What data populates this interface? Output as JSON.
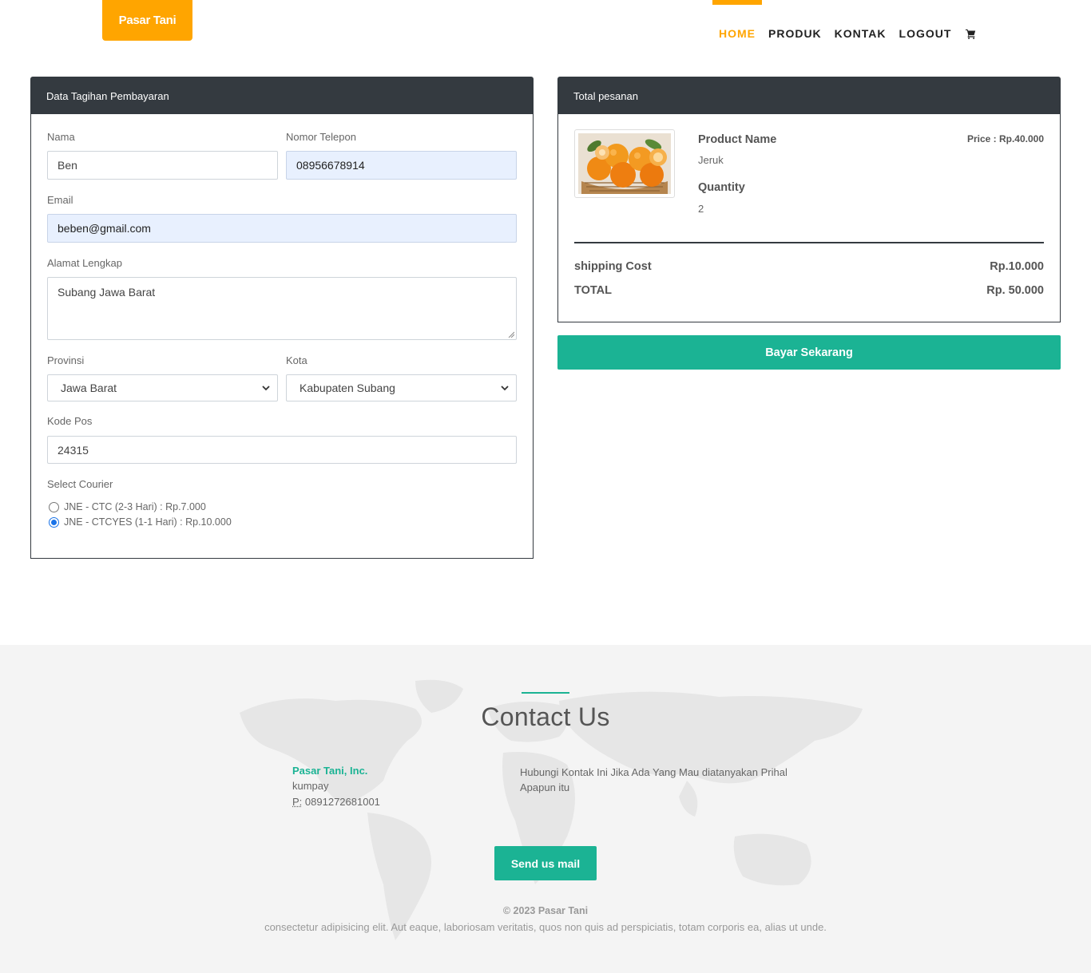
{
  "brand": "Pasar Tani",
  "nav": [
    {
      "label": "HOME",
      "active": true
    },
    {
      "label": "PRODUK",
      "active": false
    },
    {
      "label": "KONTAK",
      "active": false
    },
    {
      "label": "LOGOUT",
      "active": false
    }
  ],
  "billing": {
    "title": "Data Tagihan Pembayaran",
    "nama_label": "Nama",
    "nama_value": "Ben",
    "telepon_label": "Nomor Telepon",
    "telepon_value": "08956678914",
    "email_label": "Email",
    "email_value": "beben@gmail.com",
    "alamat_label": "Alamat Lengkap",
    "alamat_value": "Subang Jawa Barat",
    "provinsi_label": "Provinsi",
    "provinsi_value": "Jawa Barat",
    "kota_label": "Kota",
    "kota_value": "Kabupaten Subang",
    "kodepos_label": "Kode Pos",
    "kodepos_value": "24315",
    "courier_label": "Select Courier",
    "couriers": [
      {
        "label": "JNE - CTC (2-3 Hari) : Rp.7.000",
        "checked": false
      },
      {
        "label": "JNE - CTCYES (1-1 Hari) : Rp.10.000",
        "checked": true
      }
    ]
  },
  "order": {
    "title": "Total pesanan",
    "product_name_label": "Product Name",
    "product_name": "Jeruk",
    "quantity_label": "Quantity",
    "quantity": "2",
    "price": "Price : Rp.40.000",
    "shipping_label": "shipping Cost",
    "shipping_value": "Rp.10.000",
    "total_label": "TOTAL",
    "total_value": "Rp. 50.000",
    "pay_button": "Bayar Sekarang"
  },
  "footer": {
    "title": "Contact Us",
    "company": "Pasar Tani, Inc.",
    "address": "kumpay",
    "phone_prefix": "P:",
    "phone": "0891272681001",
    "description": "Hubungi Kontak Ini Jika Ada Yang Mau diatanyakan Prihal Apapun itu",
    "mail_button": "Send us mail",
    "copyright": "© 2023 Pasar Tani",
    "lorem": "consectetur adipisicing elit. Aut eaque, laboriosam veritatis, quos non quis ad perspiciatis, totam corporis ea, alias ut unde."
  },
  "colors": {
    "brand": "#ffa500",
    "dark": "#343a40",
    "accent": "#1bb394"
  }
}
